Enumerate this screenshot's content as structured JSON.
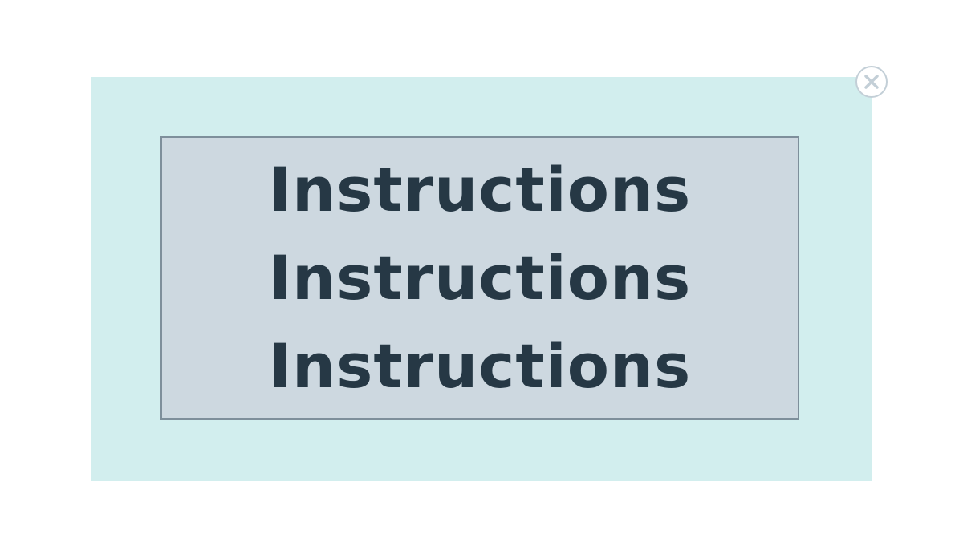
{
  "instructions": {
    "lines": [
      "Instructions",
      "Instructions",
      "Instructions"
    ]
  },
  "close_button": {
    "icon": "close-icon"
  },
  "colors": {
    "modal_background": "#d2eeee",
    "box_background": "#cdd8e0",
    "box_border": "#7e8f9b",
    "text": "#263845",
    "close_icon": "#c3cfd7"
  }
}
